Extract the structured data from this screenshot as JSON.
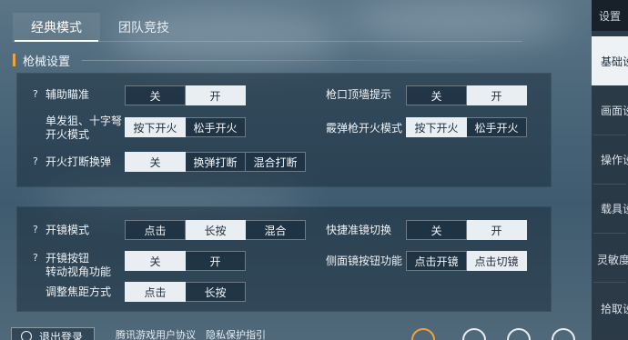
{
  "tabs": [
    {
      "label": "经典模式",
      "active": true
    },
    {
      "label": "团队竞技",
      "active": false
    }
  ],
  "section": {
    "title": "枪械设置"
  },
  "panel1": {
    "aim_assist": {
      "label": "辅助瞄准",
      "options": [
        "关",
        "开"
      ],
      "selected": "开"
    },
    "muzzle_wall_hint": {
      "label": "枪口顶墙提示",
      "options": [
        "关",
        "开"
      ],
      "selected": "开"
    },
    "single_shot_fire": {
      "label": "单发狙、十字弩\n开火模式",
      "options": [
        "按下开火",
        "松手开火"
      ],
      "selected": "按下开火"
    },
    "shotgun_fire": {
      "label": "霰弹枪开火模式",
      "options": [
        "按下开火",
        "松手开火"
      ],
      "selected": "按下开火"
    },
    "fire_interrupt_reload": {
      "label": "开火打断换弹",
      "options": [
        "关",
        "换弹打断",
        "混合打断"
      ],
      "selected": "关"
    }
  },
  "panel2": {
    "scope_mode": {
      "label": "开镜模式",
      "options": [
        "点击",
        "长按",
        "混合"
      ],
      "selected": "长按"
    },
    "quick_scope_switch": {
      "label": "快捷准镜切换",
      "options": [
        "关",
        "开"
      ],
      "selected": "开"
    },
    "scope_button_rotate": {
      "label": "开镜按钮\n转动视角功能",
      "options": [
        "关",
        "开"
      ],
      "selected": "关"
    },
    "side_scope_button": {
      "label": "侧面镜按钮功能",
      "options": [
        "点击开镜",
        "点击切镜"
      ],
      "selected": "点击切镜"
    },
    "focus_adjust": {
      "label": "调整焦距方式",
      "options": [
        "点击",
        "长按"
      ],
      "selected": "点击"
    }
  },
  "sidebar": {
    "header": "设置",
    "items": [
      {
        "label": "基础设置",
        "active": true
      },
      {
        "label": "画面设置",
        "active": false
      },
      {
        "label": "操作设置",
        "active": false
      },
      {
        "label": "载具设置",
        "active": false
      },
      {
        "label": "灵敏度设置",
        "active": false
      },
      {
        "label": "拾取设置",
        "active": false
      }
    ]
  },
  "footer": {
    "logout": "退出登录",
    "user_agreement": "腾讯游戏用户协议",
    "privacy": "隐私保护指引"
  },
  "colors": {
    "accent": "#f0a23c",
    "selected_bg": "#e9eef3"
  }
}
